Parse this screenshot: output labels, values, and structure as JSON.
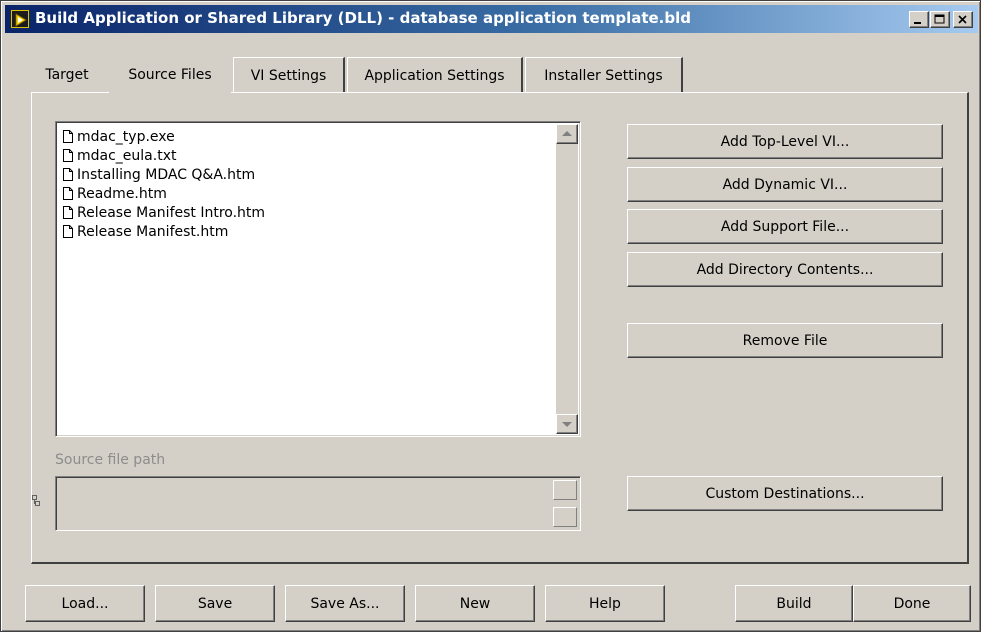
{
  "window": {
    "title": "Build Application or Shared Library (DLL) - database application template.bld",
    "icon": "labview-run-icon",
    "controls": [
      "minimize",
      "maximize",
      "close"
    ]
  },
  "tabs": [
    {
      "label": "Target",
      "selected": false
    },
    {
      "label": "Source Files",
      "selected": true
    },
    {
      "label": "VI Settings",
      "selected": false
    },
    {
      "label": "Application Settings",
      "selected": false
    },
    {
      "label": "Installer Settings",
      "selected": false
    }
  ],
  "source_files": {
    "files": [
      "mdac_typ.exe",
      "mdac_eula.txt",
      "Installing MDAC Q&A.htm",
      "Readme.htm",
      "Release Manifest Intro.htm",
      "Release Manifest.htm"
    ],
    "path_label": "Source file path",
    "path_value": ""
  },
  "side_buttons": {
    "add_top_level": "Add Top-Level VI...",
    "add_dynamic": "Add Dynamic VI...",
    "add_support": "Add Support File...",
    "add_directory": "Add Directory Contents...",
    "remove": "Remove File",
    "custom_destinations": "Custom Destinations..."
  },
  "bottom_buttons": {
    "load": "Load...",
    "save": "Save",
    "save_as": "Save As...",
    "new": "New",
    "help": "Help",
    "build": "Build",
    "done": "Done"
  },
  "colors": {
    "face": "#d4d0c8",
    "title_start": "#0a246a",
    "title_end": "#a6caf0",
    "disabled_text": "#8c8c8c"
  }
}
